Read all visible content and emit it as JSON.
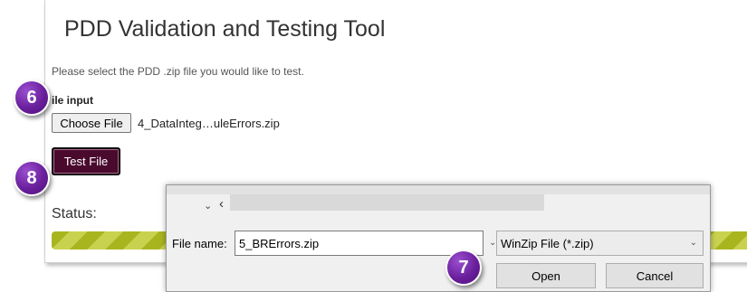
{
  "page": {
    "title": "PDD Validation and Testing Tool",
    "instruction": "Please select the PDD .zip file you would like to test.",
    "file_input_label": "ile input",
    "choose_file_label": "Choose File",
    "chosen_file_name": "4_DataInteg…uleErrors.zip",
    "test_file_label": "Test File",
    "status_label": "Status:"
  },
  "badges": {
    "step_6": "6",
    "step_7": "7",
    "step_8": "8",
    "color": "#6a1f9c"
  },
  "dialog": {
    "back_icon": "chevron-left-icon",
    "filename_label": "File name:",
    "filename_value": "5_BRErrors.zip",
    "filetype_value": "WinZip File (*.zip)",
    "open_label": "Open",
    "cancel_label": "Cancel"
  },
  "colors": {
    "test_button": "#4a0a2e",
    "progress_stripe_dark": "#a8b51f",
    "progress_stripe_light": "#c9d24f"
  }
}
